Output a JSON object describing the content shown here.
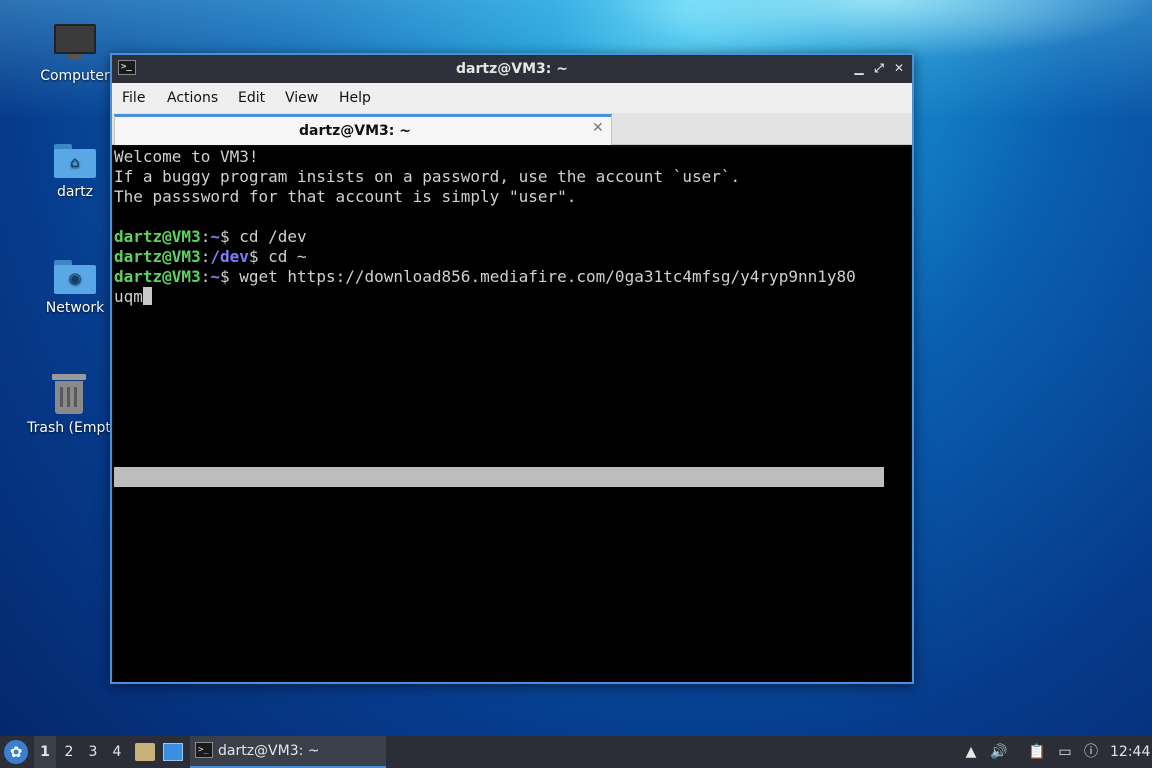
{
  "desktop": {
    "icons": [
      {
        "label": "Computer",
        "icon": "monitor-icon"
      },
      {
        "label": "dartz",
        "icon": "home-folder-icon"
      },
      {
        "label": "Network",
        "icon": "network-folder-icon"
      },
      {
        "label": "Trash (Empt",
        "icon": "trash-icon"
      }
    ]
  },
  "window": {
    "title": "dartz@VM3: ~",
    "controls": {
      "minimize": "▁",
      "maximize": "⤢",
      "close": "✕"
    },
    "menu": [
      "File",
      "Actions",
      "Edit",
      "View",
      "Help"
    ],
    "tab": {
      "title": "dartz@VM3: ~",
      "close": "✕"
    }
  },
  "terminal": {
    "welcome": [
      "Welcome to VM3!",
      "If a buggy program insists on a password, use the account `user`.",
      "The passsword for that account is simply \"user\"."
    ],
    "prompts": [
      {
        "user": "dartz@VM3",
        "sep": ":",
        "path": "~",
        "rest": "$ cd /dev"
      },
      {
        "user": "dartz@VM3",
        "sep": ":",
        "path": "/dev",
        "rest": "$ cd ~"
      },
      {
        "user": "dartz@VM3",
        "sep": ":",
        "path": "~",
        "rest": "$ wget https://download856.mediafire.com/0ga31tc4mfsg/y4ryp9nn1y80"
      }
    ],
    "wrapped": "uqm"
  },
  "taskbar": {
    "workspaces": [
      "1",
      "2",
      "3",
      "4"
    ],
    "active_workspace": "1",
    "task_label": "dartz@VM3: ~",
    "clock": "12:44",
    "colors": {
      "accent": "#4a8fd9",
      "prompt_user": "#5fd35f",
      "prompt_path": "#7d7dff"
    }
  }
}
